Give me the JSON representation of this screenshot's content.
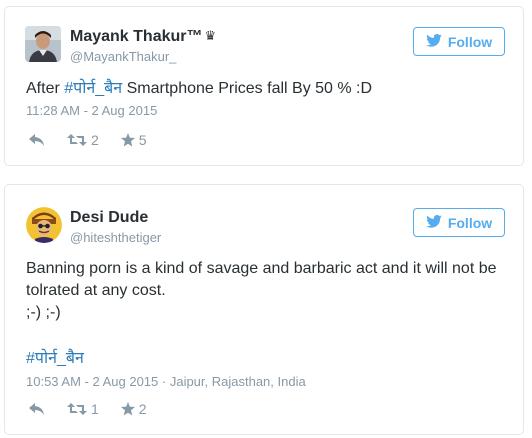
{
  "tweets": [
    {
      "display_name": "Mayank Thakur™",
      "verified_crown": "♛",
      "handle": "@MayankThakur_",
      "follow_label": "Follow",
      "text_prefix": "After ",
      "hashtag": "#पोर्न_बैन",
      "text_suffix": " Smartphone Prices fall By 50 % :D",
      "timestamp": "11:28 AM - 2 Aug 2015",
      "retweets": "2",
      "favorites": "5"
    },
    {
      "display_name": "Desi Dude",
      "handle": "@hiteshthetiger",
      "follow_label": "Follow",
      "text": "Banning porn is a kind of savage and barbaric act and it will not be tolrated at any cost.",
      "text_line3": ";-) ;-)",
      "hashtag": "#पोर्न_बैन",
      "timestamp": "10:53 AM - 2 Aug 2015",
      "location": " · Jaipur, Rajasthan, India",
      "retweets": "1",
      "favorites": "2"
    }
  ],
  "colors": {
    "accent": "#55acee",
    "hashtag": "#2b7bb9",
    "muted": "#8899a6",
    "border": "#e1e8ed"
  },
  "icons": [
    "twitter-bird-icon",
    "reply-icon",
    "retweet-icon",
    "star-icon"
  ]
}
